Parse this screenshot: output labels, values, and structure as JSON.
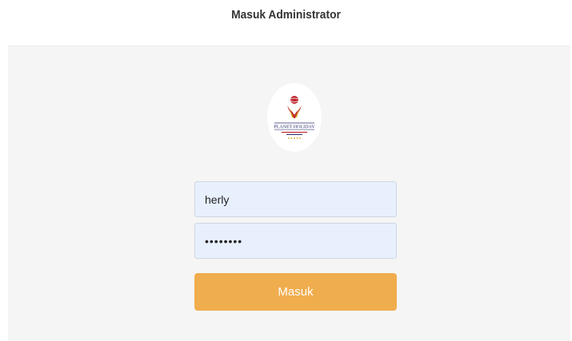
{
  "header": {
    "title": "Masuk Administrator"
  },
  "logo": {
    "icon": "planet-holiday-logo",
    "text": "PLANET HOLIDAY"
  },
  "form": {
    "username": {
      "value": "herly",
      "placeholder": ""
    },
    "password": {
      "value": "password",
      "placeholder": ""
    },
    "submit_label": "Masuk"
  },
  "colors": {
    "background": "#ffffff",
    "card": "#f5f5f5",
    "input_bg": "#e8f0fe",
    "button": "#f0ad4e",
    "button_text": "#ffffff",
    "brand_red": "#c0262e",
    "brand_navy": "#2a2f6e",
    "brand_gold": "#d4a017"
  }
}
